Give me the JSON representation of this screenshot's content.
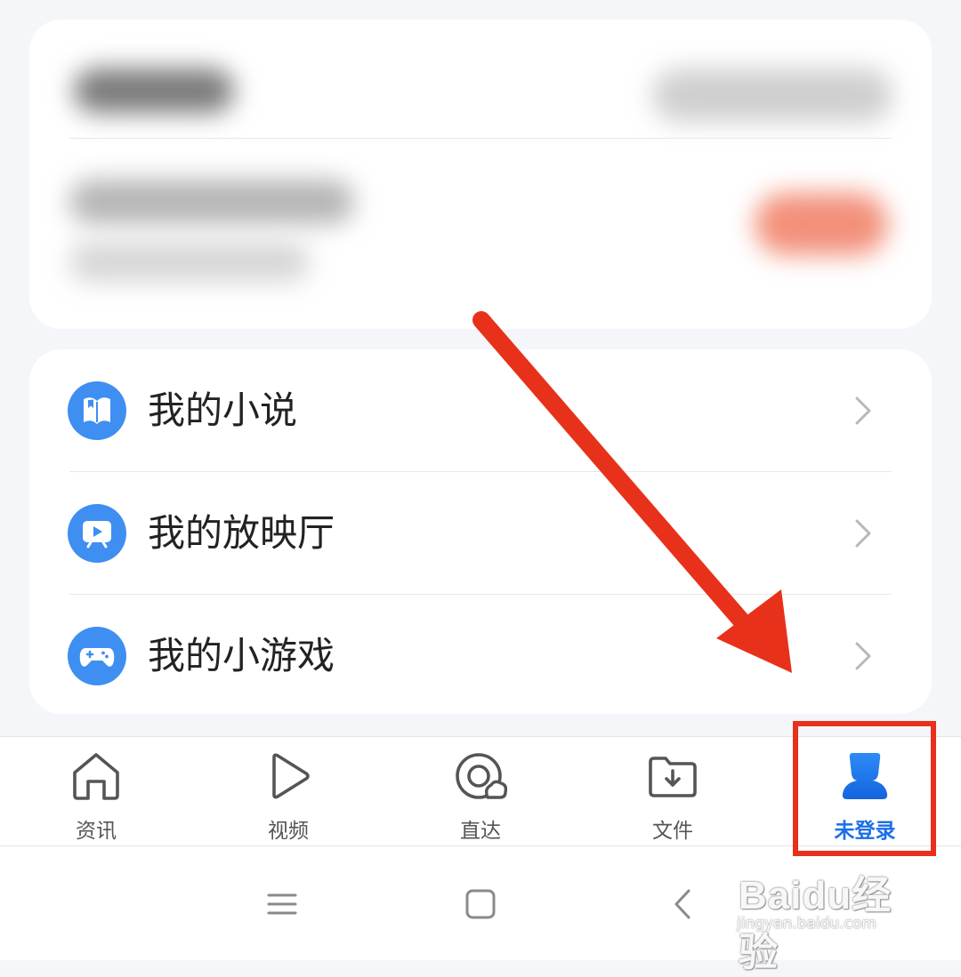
{
  "menu": {
    "items": [
      {
        "label": "我的小说",
        "icon": "book-icon"
      },
      {
        "label": "我的放映厅",
        "icon": "screen-play-icon"
      },
      {
        "label": "我的小游戏",
        "icon": "gamepad-icon"
      }
    ]
  },
  "bottom_nav": {
    "tabs": [
      {
        "label": "资讯",
        "icon": "home-icon"
      },
      {
        "label": "视频",
        "icon": "play-icon"
      },
      {
        "label": "直达",
        "icon": "direct-icon"
      },
      {
        "label": "文件",
        "icon": "folder-download-icon"
      },
      {
        "label": "未登录",
        "icon": "user-icon",
        "active": true
      }
    ]
  },
  "system_nav": {
    "icons": [
      "menu-icon",
      "home-square-icon",
      "back-icon"
    ]
  },
  "watermark": {
    "brand": "Baidu经验",
    "url": "jingyan.baidu.com"
  },
  "colors": {
    "accent": "#1a6ee8",
    "icon_blue": "#3f8ef2",
    "annotation_red": "#e8311a",
    "background": "#f5f6fa"
  }
}
